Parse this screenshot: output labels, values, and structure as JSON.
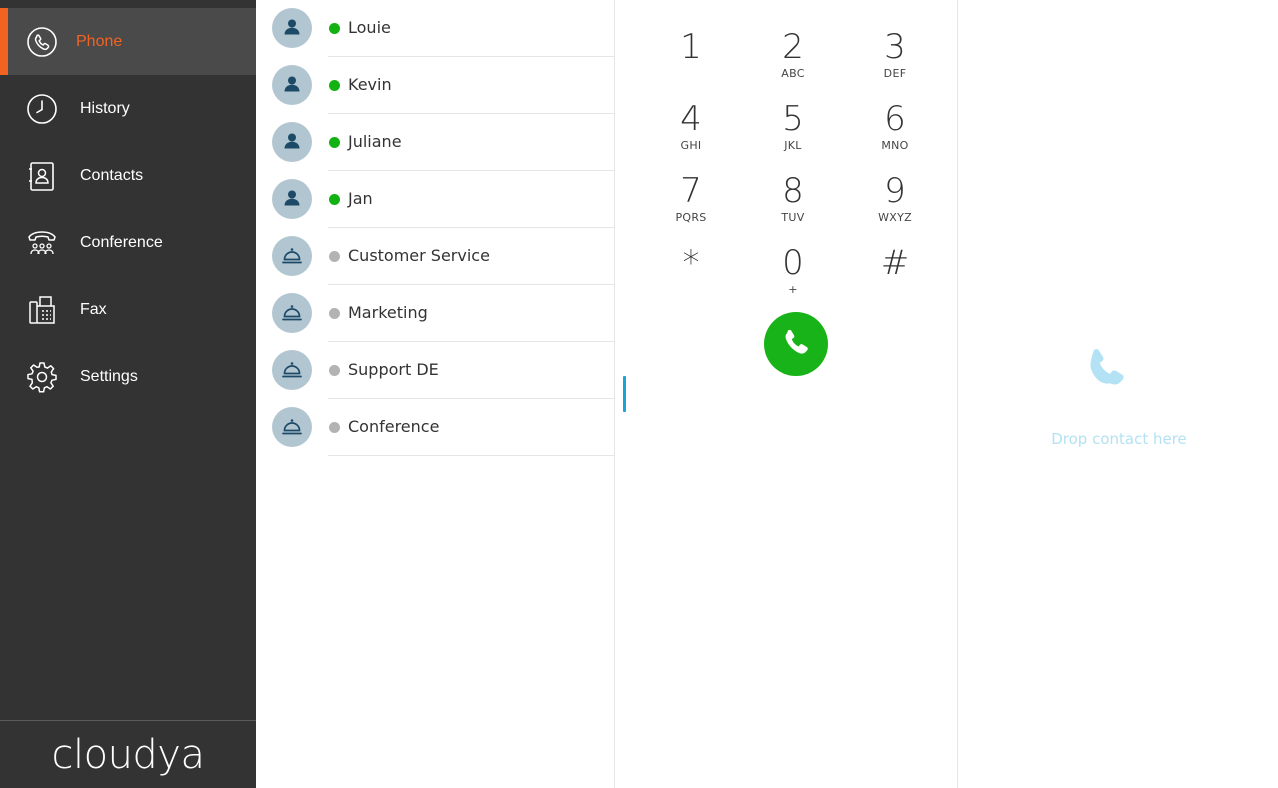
{
  "sidebar": {
    "items": [
      {
        "label": "Phone",
        "icon": "phone-icon",
        "active": true
      },
      {
        "label": "History",
        "icon": "clock-icon",
        "active": false
      },
      {
        "label": "Contacts",
        "icon": "contact-card-icon",
        "active": false
      },
      {
        "label": "Conference",
        "icon": "conference-phone-icon",
        "active": false
      },
      {
        "label": "Fax",
        "icon": "fax-icon",
        "active": false
      },
      {
        "label": "Settings",
        "icon": "gear-icon",
        "active": false
      }
    ],
    "brand": "cloudya",
    "accent_color": "#f26322"
  },
  "contacts": [
    {
      "name": "Louie",
      "type": "user",
      "status": "online"
    },
    {
      "name": "Kevin",
      "type": "user",
      "status": "online"
    },
    {
      "name": "Juliane",
      "type": "user",
      "status": "online"
    },
    {
      "name": "Jan",
      "type": "user",
      "status": "online"
    },
    {
      "name": "Customer Service",
      "type": "group",
      "status": "offline"
    },
    {
      "name": "Marketing",
      "type": "group",
      "status": "offline"
    },
    {
      "name": "Support DE",
      "type": "group",
      "status": "offline"
    },
    {
      "name": "Conference",
      "type": "group",
      "status": "offline"
    }
  ],
  "status_colors": {
    "online": "#11b211",
    "offline": "#b3b3b3"
  },
  "dialpad": {
    "keys": [
      {
        "num": "1",
        "letters": ""
      },
      {
        "num": "2",
        "letters": "ABC"
      },
      {
        "num": "3",
        "letters": "DEF"
      },
      {
        "num": "4",
        "letters": "GHI"
      },
      {
        "num": "5",
        "letters": "JKL"
      },
      {
        "num": "6",
        "letters": "MNO"
      },
      {
        "num": "7",
        "letters": "PQRS"
      },
      {
        "num": "8",
        "letters": "TUV"
      },
      {
        "num": "9",
        "letters": "WXYZ"
      },
      {
        "num": "*",
        "letters": ""
      },
      {
        "num": "0",
        "letters": "+"
      },
      {
        "num": "#",
        "letters": ""
      }
    ],
    "call_color": "#18b318"
  },
  "dropzone": {
    "text": "Drop contact here",
    "color": "#b3e2f4"
  }
}
